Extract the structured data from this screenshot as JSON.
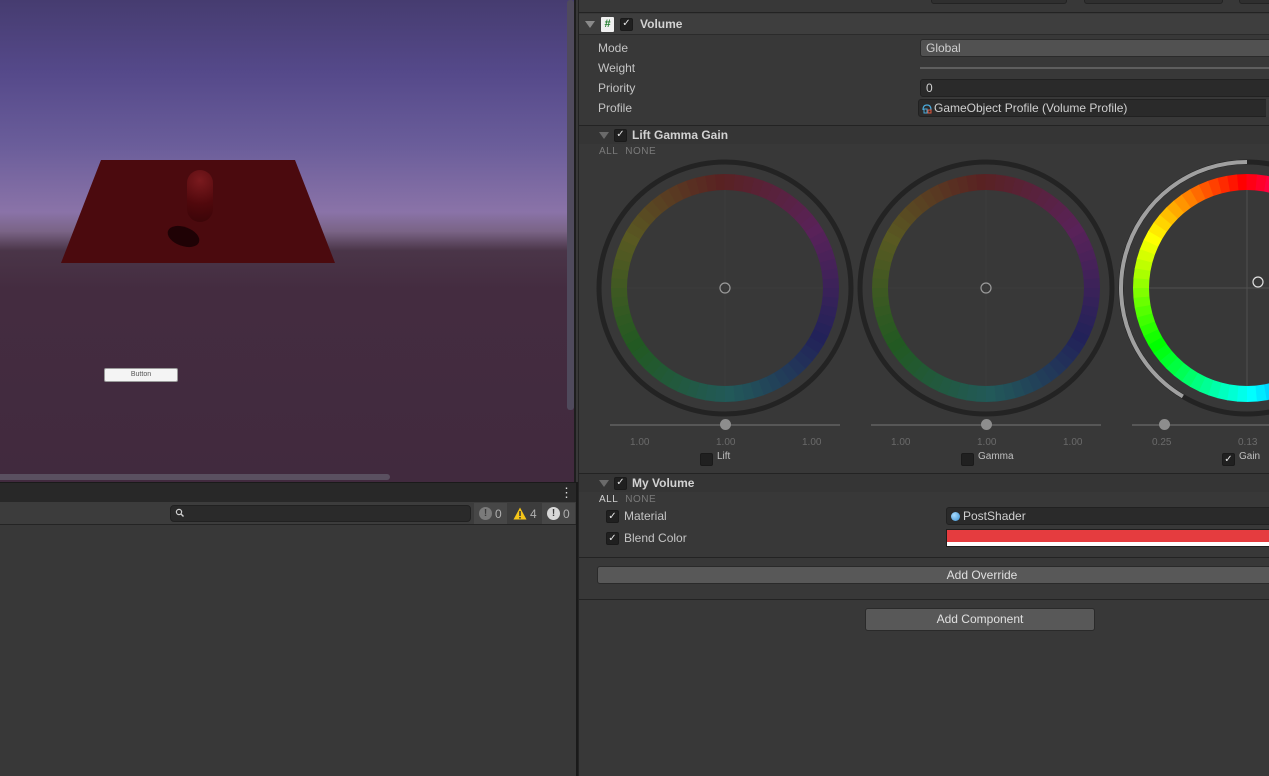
{
  "game_view": {
    "ui_button_label": "Button"
  },
  "console": {
    "menu_icon": "vertical-ellipsis-icon",
    "search": {
      "value": "",
      "placeholder": ""
    },
    "counters": {
      "errors": "0",
      "warnings": "4",
      "messages": "0"
    },
    "icons": {
      "search": "search-icon",
      "error": "error-icon",
      "warning": "warning-icon",
      "info": "info-icon"
    }
  },
  "inspector": {
    "volume": {
      "title": "Volume",
      "enabled": true,
      "icon": "script-icon",
      "properties": [
        {
          "label": "Mode",
          "value": "Global",
          "type": "dropdown"
        },
        {
          "label": "Weight",
          "value": "",
          "type": "slider"
        },
        {
          "label": "Priority",
          "value": "0",
          "type": "number"
        },
        {
          "label": "Profile",
          "value": "GameObject Profile (Volume Profile)",
          "type": "object"
        }
      ]
    },
    "lift_gamma_gain": {
      "title": "Lift Gamma Gain",
      "enabled": true,
      "all_label": "ALL",
      "none_label": "NONE",
      "wheels": [
        {
          "name": "Lift",
          "overridden": false,
          "values": [
            "1.00",
            "1.00",
            "1.00"
          ],
          "slider": 0.5
        },
        {
          "name": "Gamma",
          "overridden": false,
          "values": [
            "1.00",
            "1.00",
            "1.00"
          ],
          "slider": 0.5
        },
        {
          "name": "Gain",
          "overridden": true,
          "values": [
            "0.25",
            "0.13"
          ],
          "slider": 0.14
        }
      ]
    },
    "my_volume": {
      "title": "My Volume",
      "enabled": true,
      "all_label": "ALL",
      "none_label": "NONE",
      "properties": [
        {
          "label": "Material",
          "overridden": true,
          "value": "PostShader"
        },
        {
          "label": "Blend Color",
          "overridden": true,
          "color": "#e53c3f"
        }
      ]
    },
    "add_override_label": "Add Override",
    "add_component_label": "Add Component"
  },
  "colors": {
    "panel_bg": "#383838",
    "blend_color": "#e53c3f",
    "warning": "#f5c518",
    "plane_red": "#4b0a0e"
  }
}
